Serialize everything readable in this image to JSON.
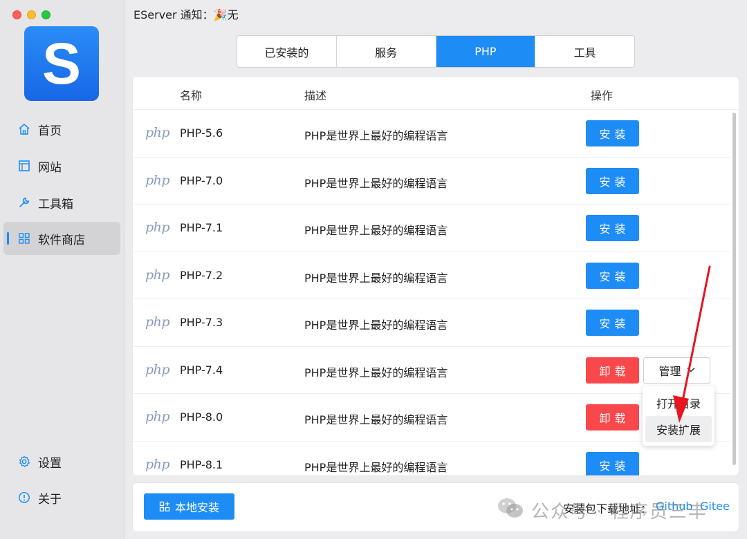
{
  "window": {
    "notice_label": "EServer 通知：",
    "notice_value": "🎉无"
  },
  "logo": {
    "letter": "S"
  },
  "sidebar": {
    "items": [
      {
        "label": "首页",
        "icon": "home-icon"
      },
      {
        "label": "网站",
        "icon": "website-icon"
      },
      {
        "label": "工具箱",
        "icon": "wrench-icon"
      },
      {
        "label": "软件商店",
        "icon": "grid-icon",
        "active": true
      },
      {
        "label": "设置",
        "icon": "gear-icon"
      },
      {
        "label": "关于",
        "icon": "info-icon"
      }
    ]
  },
  "tabs": [
    {
      "label": "已安装的"
    },
    {
      "label": "服务"
    },
    {
      "label": "PHP",
      "active": true
    },
    {
      "label": "工具"
    }
  ],
  "table": {
    "headers": {
      "name": "名称",
      "desc": "描述",
      "action": "操作"
    },
    "icon_text": "php",
    "rows": [
      {
        "name": "PHP-5.6",
        "desc": "PHP是世界上最好的编程语言",
        "action": "安装",
        "installed": false
      },
      {
        "name": "PHP-7.0",
        "desc": "PHP是世界上最好的编程语言",
        "action": "安装",
        "installed": false
      },
      {
        "name": "PHP-7.1",
        "desc": "PHP是世界上最好的编程语言",
        "action": "安装",
        "installed": false
      },
      {
        "name": "PHP-7.2",
        "desc": "PHP是世界上最好的编程语言",
        "action": "安装",
        "installed": false
      },
      {
        "name": "PHP-7.3",
        "desc": "PHP是世界上最好的编程语言",
        "action": "安装",
        "installed": false
      },
      {
        "name": "PHP-7.4",
        "desc": "PHP是世界上最好的编程语言",
        "action": "卸载",
        "installed": true,
        "manage": "管理"
      },
      {
        "name": "PHP-8.0",
        "desc": "PHP是世界上最好的编程语言",
        "action": "卸载",
        "installed": true
      },
      {
        "name": "PHP-8.1",
        "desc": "PHP是世界上最好的编程语言",
        "action": "安装",
        "installed": false
      }
    ]
  },
  "dropdown": {
    "items": [
      {
        "label": "打开目录"
      },
      {
        "label": "安装扩展",
        "hover": true
      }
    ]
  },
  "footer": {
    "local_install": "本地安装",
    "download_label": "安装包下载地址：",
    "link_github": "Github",
    "link_gitee": "Gitee"
  },
  "watermark": {
    "text": "公众号 · 程序员三丰"
  },
  "colors": {
    "accent": "#1e8cf5",
    "danger": "#f9484b",
    "arrow": "#e8141e"
  }
}
